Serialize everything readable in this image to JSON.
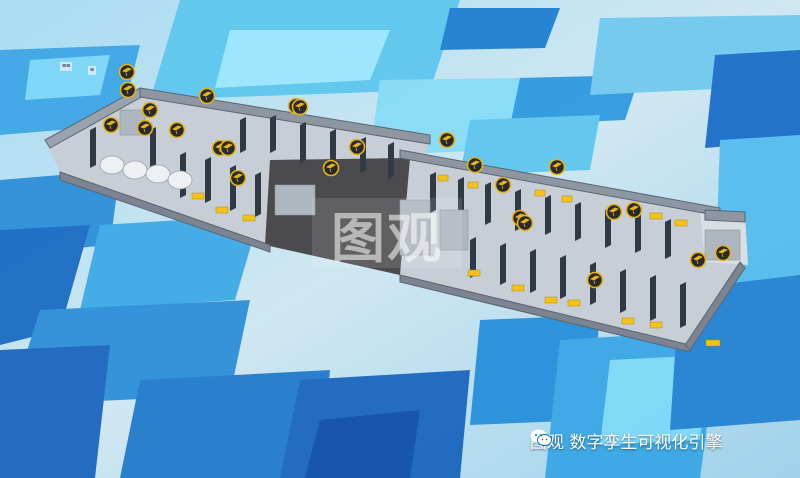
{
  "scene": {
    "type": "3d-floorplan-digital-twin",
    "colors": {
      "background": "#0b6fae",
      "panel_light": "#8fe3ff",
      "panel_mid": "#3fb0e8",
      "floor": "#c9d0d8",
      "wall": "#6e7885",
      "corridor": "#4d4d4d",
      "desk": "#f4c21b",
      "camera_marker": "#e4b51c"
    },
    "camera_icon": "cctv-camera-icon",
    "camera_count": 25
  },
  "overlay": {
    "center_watermark": "图观"
  },
  "brand": {
    "icon": "wechat-icon",
    "text": "图观 数字孪生可视化引擎"
  },
  "signs": [
    {
      "text": "≡≡"
    },
    {
      "text": "≡"
    }
  ]
}
